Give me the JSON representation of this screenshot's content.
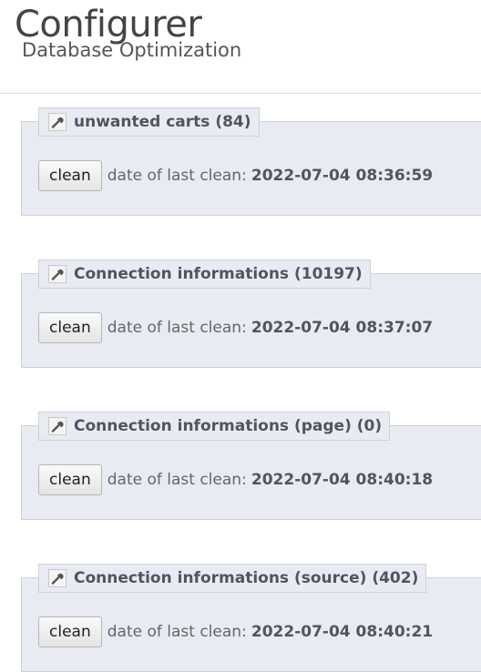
{
  "header": {
    "title": "Configurer",
    "subtitle": "Database Optimization"
  },
  "icons": {
    "section": "wrench-icon"
  },
  "sections": [
    {
      "title": "unwanted carts (84)",
      "button_label": "clean",
      "last_clean_label": "date of last clean:",
      "last_clean_date": "2022-07-04 08:36:59"
    },
    {
      "title": "Connection informations (10197)",
      "button_label": "clean",
      "last_clean_label": "date of last clean:",
      "last_clean_date": "2022-07-04 08:37:07"
    },
    {
      "title": "Connection informations (page) (0)",
      "button_label": "clean",
      "last_clean_label": "date of last clean:",
      "last_clean_date": "2022-07-04 08:40:18"
    },
    {
      "title": "Connection informations (source) (402)",
      "button_label": "clean",
      "last_clean_label": "date of last clean:",
      "last_clean_date": "2022-07-04 08:40:21"
    }
  ]
}
